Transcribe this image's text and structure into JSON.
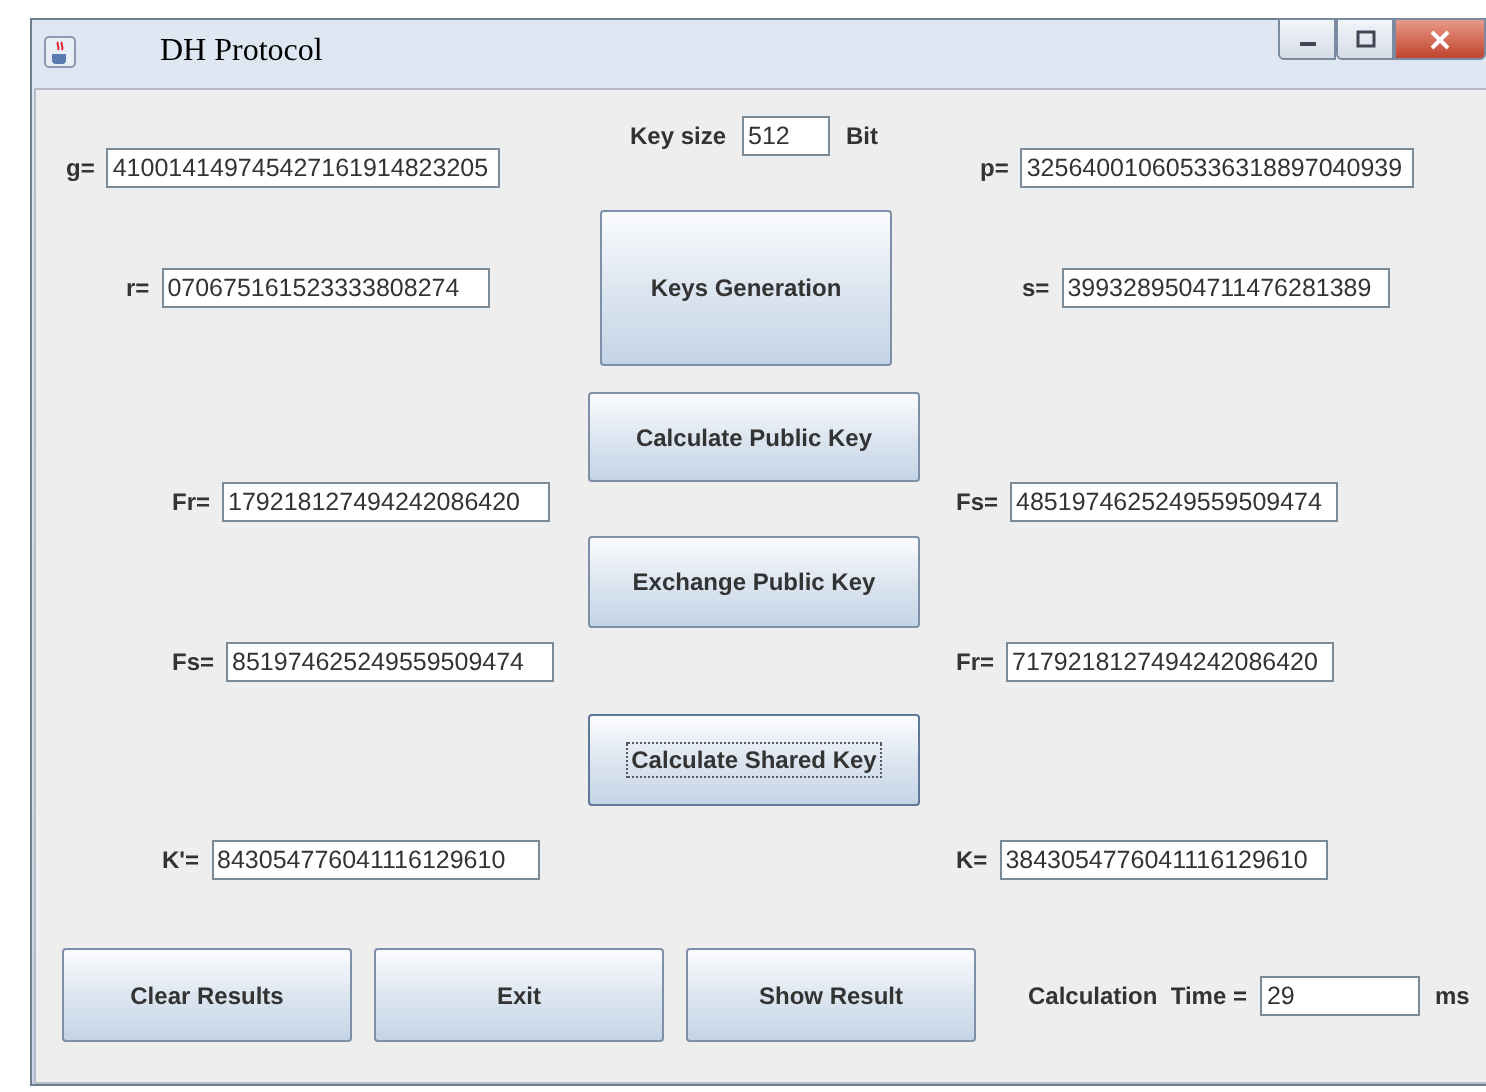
{
  "window": {
    "title": "DH Protocol"
  },
  "rows": [
    {
      "left": {
        "label": "g=",
        "value": "410014149745427161914823205"
      },
      "center": {
        "kind": "key_size",
        "label": "Key size",
        "value": "512",
        "unit": "Bit"
      },
      "right": {
        "label": "p=",
        "value": "325640010605336318897040939"
      }
    },
    {
      "left": {
        "label": "r=",
        "value": "070675161523333808274"
      },
      "center": {
        "kind": "button",
        "label": "Keys Generation",
        "focused": false
      },
      "right": {
        "label": "s=",
        "value": "3993289504711476281389"
      }
    },
    {
      "center": {
        "kind": "button",
        "label": "Calculate Public Key",
        "focused": false
      }
    },
    {
      "left": {
        "label": "Fr=",
        "value": "179218127494242086420"
      },
      "right": {
        "label": "Fs=",
        "value": "4851974625249559509474"
      }
    },
    {
      "center": {
        "kind": "button",
        "label": "Exchange Public Key",
        "focused": false
      }
    },
    {
      "left": {
        "label": "Fs=",
        "value": "851974625249559509474"
      },
      "right": {
        "label": "Fr=",
        "value": "7179218127494242086420"
      }
    },
    {
      "center": {
        "kind": "button",
        "label": "Calculate Shared Key",
        "focused": true
      }
    },
    {
      "left": {
        "label": "K'=",
        "value": "843054776041116129610"
      },
      "right": {
        "label": "K=",
        "value": "3843054776041116129610"
      }
    }
  ],
  "bottom": {
    "buttons": [
      {
        "label": "Clear Results",
        "focused": false
      },
      {
        "label": "Exit",
        "focused": false
      },
      {
        "label": "Show Result",
        "focused": false
      }
    ],
    "time": {
      "label": "Calculation  Time =",
      "value": "29",
      "unit": "ms"
    }
  }
}
